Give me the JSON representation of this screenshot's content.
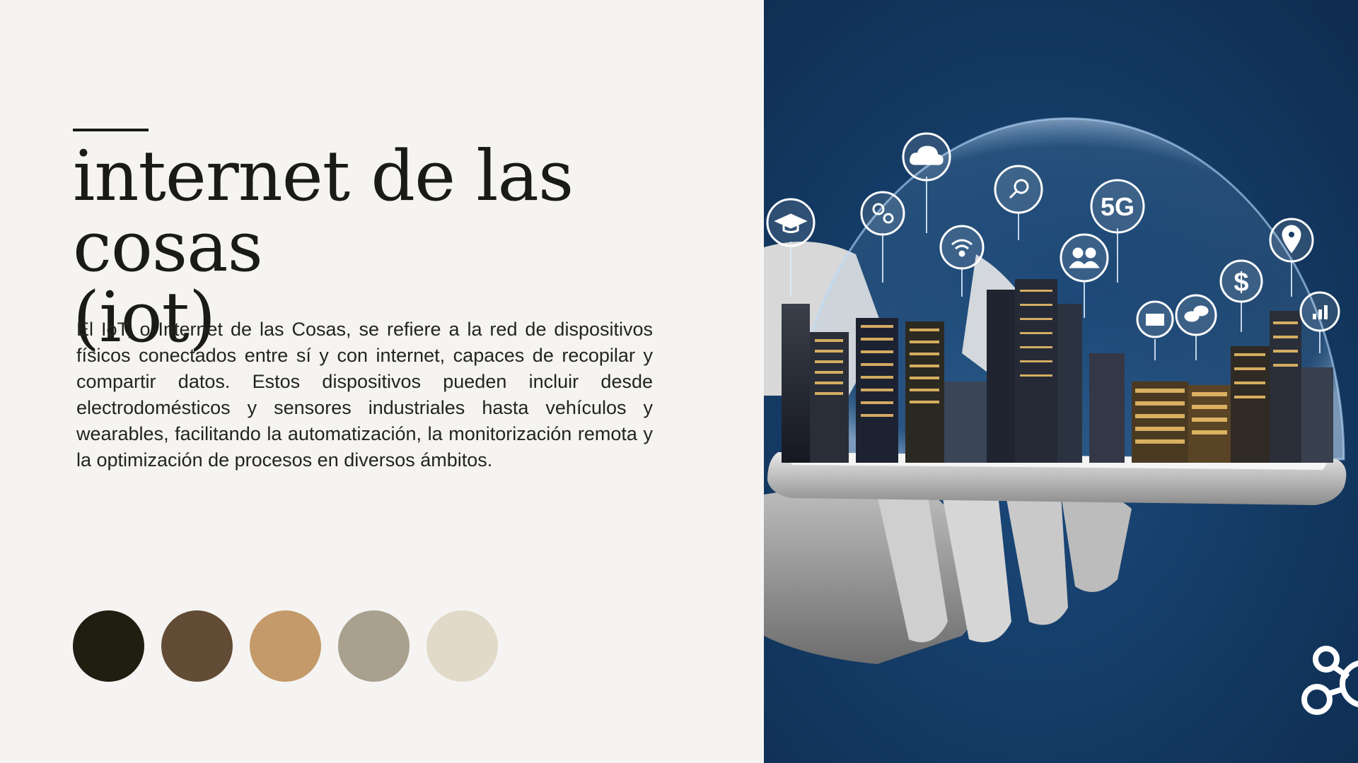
{
  "slide": {
    "title_line1": "internet de las cosas",
    "title_line2": "(iot)",
    "body": "El IoT, o Internet de las Cosas, se refiere a la red de dispositivos físicos conectados entre sí y con internet, capaces de recopilar y compartir datos. Estos dispositivos pueden incluir desde electrodomésticos y sensores industriales hasta vehículos y wearables, facilitando la automatización, la monitorización remota y la optimización de procesos en diversos ámbitos."
  },
  "palette": [
    "#1f1e10",
    "#634c35",
    "#c49a6a",
    "#a9a08e",
    "#e1dac8"
  ],
  "image": {
    "icons": [
      "graduation-cap-icon",
      "gears-icon",
      "cloud-icon",
      "wifi-icon",
      "search-icon",
      "people-icon",
      "5g-icon",
      "mail-icon",
      "chat-icon",
      "dollar-icon",
      "location-pin-icon",
      "bar-chart-icon",
      "network-nodes-icon"
    ],
    "icon_5g_text": "5G",
    "icon_dollar_text": "$"
  }
}
